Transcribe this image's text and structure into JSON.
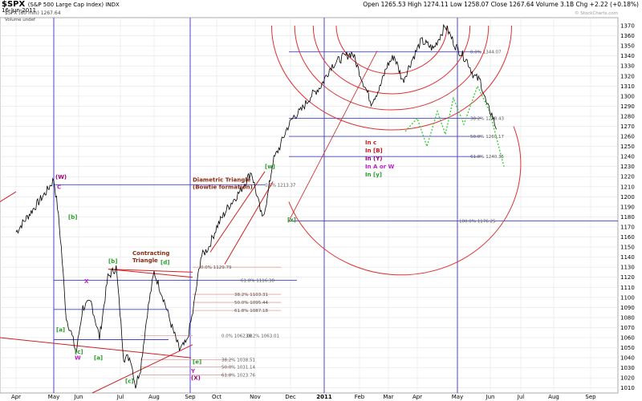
{
  "header": {
    "symbol": "$SPX",
    "description": "(S&P 500 Large Cap Index) INDX",
    "series_label": "$SPX (60 min) 1267.64",
    "volume_label": "Volume undef",
    "date": "16-Jun-2011",
    "ohlc": "Open 1265.53  High 1274.11  Low 1258.07  Close 1267.64  Volume 3.1B  Chg +2.22 (+0.18%)",
    "credit": "© StockCharts.com"
  },
  "chart_data": {
    "type": "line",
    "title": "$SPX (S&P 500 Large Cap Index) INDX",
    "y_ticks": [
      1010,
      1020,
      1030,
      1040,
      1050,
      1060,
      1070,
      1080,
      1090,
      1100,
      1110,
      1120,
      1130,
      1140,
      1150,
      1160,
      1170,
      1180,
      1190,
      1200,
      1210,
      1220,
      1230,
      1240,
      1250,
      1260,
      1270,
      1280,
      1290,
      1300,
      1310,
      1320,
      1330,
      1340,
      1350,
      1360,
      1370
    ],
    "ylim": [
      1005,
      1378
    ],
    "x_ticks": [
      "Apr",
      "May",
      "Jun",
      "Jul",
      "Aug",
      "Sep",
      "Oct",
      "Nov",
      "Dec",
      "2011",
      "Feb",
      "Mar",
      "Apr",
      "May",
      "Jun",
      "Jul",
      "Aug",
      "Sep"
    ],
    "series": [
      {
        "name": "$SPX (60 min)",
        "color": "#000000",
        "x": [
          0,
          0.4,
          0.8,
          1.0,
          1.15,
          1.3,
          1.5,
          1.7,
          1.9,
          2.1,
          2.3,
          2.5,
          2.7,
          2.9,
          3.1,
          3.3,
          3.45,
          3.6,
          3.8,
          4.0,
          4.25,
          4.5,
          4.7,
          4.9,
          5.1,
          5.4,
          5.7,
          6.0,
          6.3,
          6.6,
          6.9,
          7.2,
          7.35,
          7.5,
          7.7,
          7.9,
          8.1,
          8.3,
          8.6,
          8.9,
          9.2,
          9.5,
          9.8,
          10.1,
          10.4,
          10.7,
          10.95,
          11.2,
          11.5,
          11.8,
          12.1,
          12.4,
          12.7,
          12.95,
          13.1,
          13.3,
          13.5,
          13.7,
          13.9,
          14.05,
          14.2
        ],
        "y": [
          1165,
          1185,
          1205,
          1217,
          1190,
          1150,
          1080,
          1065,
          1045,
          1090,
          1095,
          1060,
          1120,
          1130,
          1040,
          1040,
          1012,
          1030,
          1085,
          1125,
          1100,
          1070,
          1048,
          1055,
          1085,
          1140,
          1150,
          1170,
          1190,
          1205,
          1225,
          1178,
          1200,
          1235,
          1250,
          1268,
          1280,
          1285,
          1300,
          1310,
          1330,
          1338,
          1343,
          1316,
          1294,
          1308,
          1330,
          1340,
          1315,
          1335,
          1355,
          1347,
          1370,
          1350,
          1343,
          1335,
          1320,
          1315,
          1290,
          1282,
          1267
        ]
      }
    ]
  },
  "annotations": {
    "labels": [
      {
        "text": "(W)",
        "color": "#9c007a"
      },
      {
        "text": "C",
        "color": "#c01ecc"
      },
      {
        "text": "[b]",
        "color": "#2a9e2a"
      },
      {
        "text": "[a]",
        "color": "#2a9e2a"
      },
      {
        "text": "[c]",
        "color": "#2a9e2a"
      },
      {
        "text": "W",
        "color": "#c01ecc"
      },
      {
        "text": "X",
        "color": "#c01ecc"
      },
      {
        "text": "[a]",
        "color": "#2a9e2a"
      },
      {
        "text": "[b]",
        "color": "#2a9e2a"
      },
      {
        "text": "[c]",
        "color": "#2a9e2a"
      },
      {
        "text": "[d]",
        "color": "#2a9e2a"
      },
      {
        "text": "[e]",
        "color": "#2a9e2a"
      },
      {
        "text": "Y",
        "color": "#c01ecc"
      },
      {
        "text": "(X)",
        "color": "#9c007a"
      },
      {
        "text": "[w]",
        "color": "#2a9e2a"
      },
      {
        "text": "[x]",
        "color": "#2a9e2a"
      },
      {
        "text": "Contracting",
        "color": "#8b2a10"
      },
      {
        "text": "Triangle",
        "color": "#8b2a10"
      },
      {
        "text": "Diametric Triangle",
        "color": "#8b2a10"
      },
      {
        "text": "(Bowtie formation)",
        "color": "#8b2a10"
      }
    ],
    "legend": [
      {
        "text": "In c",
        "color": "#d01818"
      },
      {
        "text": "In [B]",
        "color": "#d01818"
      },
      {
        "text": "In (Y)",
        "color": "#9c007a"
      },
      {
        "text": "In A or W",
        "color": "#c01ecc"
      },
      {
        "text": "In [y]",
        "color": "#2a9e2a"
      }
    ],
    "fib_labels": [
      "0.0% 1129.79",
      "61.8% 1116.38",
      "38.2% 1103.31",
      "50.0% 1095.44",
      "61.8% 1087.18",
      "0.0% 1062.08",
      "38.2% 1063.01",
      "38.2% 1038.51",
      "50.0% 1031.14",
      "61.8% 1023.76",
      "0.0% 1213.37",
      "100.0% 1176.25",
      "0.0% 1344.07",
      "38.2% 1278.43",
      "50.0% 1260.17",
      "61.8% 1240.35"
    ]
  }
}
